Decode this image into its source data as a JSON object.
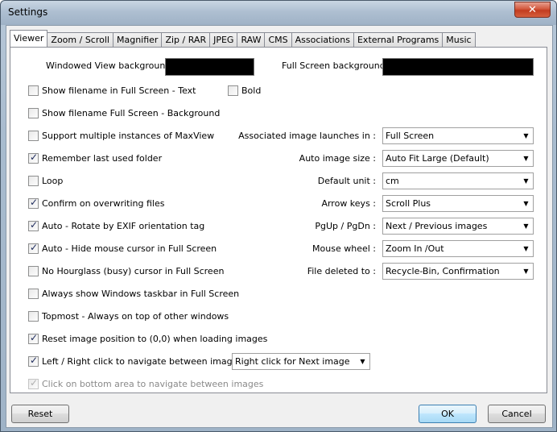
{
  "window": {
    "title": "Settings",
    "close_label": "✕"
  },
  "tabs": [
    {
      "label": "Viewer",
      "active": true
    },
    {
      "label": "Zoom / Scroll"
    },
    {
      "label": "Magnifier"
    },
    {
      "label": "Zip / RAR"
    },
    {
      "label": "JPEG"
    },
    {
      "label": "RAW"
    },
    {
      "label": "CMS"
    },
    {
      "label": "Associations"
    },
    {
      "label": "External Programs"
    },
    {
      "label": "Music"
    }
  ],
  "backgrounds": {
    "windowed_label": "Windowed View background :",
    "windowed_color": "#000000",
    "fullscreen_label": "Full Screen background :",
    "fullscreen_color": "#000000"
  },
  "checkboxes": {
    "show_filename_text": {
      "label": "Show filename in Full Screen - Text",
      "checked": false
    },
    "bold": {
      "label": "Bold",
      "checked": false
    },
    "show_filename_bg": {
      "label": "Show filename Full Screen - Background",
      "checked": false
    },
    "multiple_instances": {
      "label": "Support multiple instances of MaxView",
      "checked": false
    },
    "remember_folder": {
      "label": "Remember last used folder",
      "checked": true
    },
    "loop": {
      "label": "Loop",
      "checked": false
    },
    "confirm_overwrite": {
      "label": "Confirm on overwriting files",
      "checked": true
    },
    "auto_rotate": {
      "label": "Auto - Rotate by EXIF orientation tag",
      "checked": true
    },
    "auto_hide_cursor": {
      "label": "Auto - Hide mouse cursor in Full Screen",
      "checked": true
    },
    "no_hourglass": {
      "label": "No Hourglass (busy) cursor in Full Screen",
      "checked": false
    },
    "show_taskbar": {
      "label": "Always show Windows taskbar in Full Screen",
      "checked": false
    },
    "topmost": {
      "label": "Topmost - Always on top of other windows",
      "checked": false
    },
    "reset_position": {
      "label": "Reset image position to (0,0) when loading images",
      "checked": true
    },
    "left_right_click": {
      "label": "Left / Right click to navigate between images",
      "checked": true
    },
    "bottom_area": {
      "label": "Click on bottom area to navigate between images",
      "checked": true,
      "disabled": true
    }
  },
  "click_select": {
    "value": "Right click for Next image"
  },
  "settings": {
    "assoc_launch": {
      "label": "Associated image launches in :",
      "value": "Full Screen"
    },
    "auto_size": {
      "label": "Auto image size :",
      "value": "Auto Fit Large (Default)"
    },
    "default_unit": {
      "label": "Default unit :",
      "value": "cm"
    },
    "arrow_keys": {
      "label": "Arrow keys :",
      "value": "Scroll Plus"
    },
    "pgup_pgdn": {
      "label": "PgUp / PgDn :",
      "value": "Next / Previous images"
    },
    "mouse_wheel": {
      "label": "Mouse wheel :",
      "value": "Zoom In /Out"
    },
    "file_deleted": {
      "label": "File deleted to :",
      "value": "Recycle-Bin, Confirmation"
    }
  },
  "buttons": {
    "reset": "Reset",
    "ok": "OK",
    "cancel": "Cancel"
  }
}
